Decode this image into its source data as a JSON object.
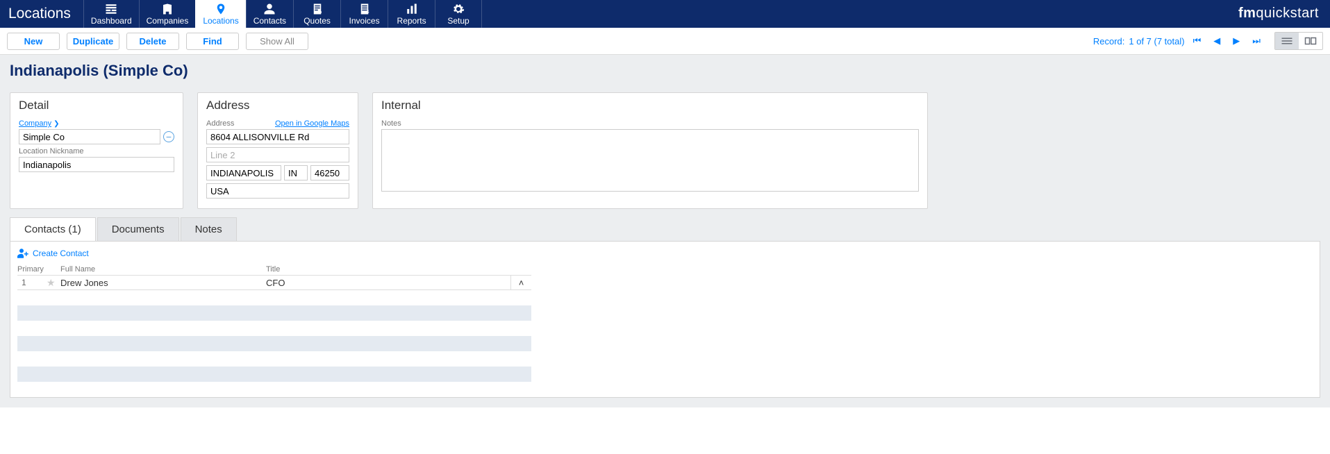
{
  "app": {
    "section_title": "Locations",
    "brand_prefix": "fm",
    "brand_main": "quickstart"
  },
  "nav": [
    {
      "label": "Dashboard",
      "active": false
    },
    {
      "label": "Companies",
      "active": false
    },
    {
      "label": "Locations",
      "active": true
    },
    {
      "label": "Contacts",
      "active": false
    },
    {
      "label": "Quotes",
      "active": false
    },
    {
      "label": "Invoices",
      "active": false
    },
    {
      "label": "Reports",
      "active": false
    },
    {
      "label": "Setup",
      "active": false
    }
  ],
  "toolbar": {
    "new": "New",
    "duplicate": "Duplicate",
    "delete": "Delete",
    "find": "Find",
    "show_all": "Show All",
    "record_label": "Record:",
    "record_status": "1 of 7 (7 total)"
  },
  "page": {
    "title": "Indianapolis (Simple Co)"
  },
  "detail": {
    "heading": "Detail",
    "company_link": "Company",
    "company_value": "Simple Co",
    "nickname_label": "Location Nickname",
    "nickname_value": "Indianapolis"
  },
  "address": {
    "heading": "Address",
    "label": "Address",
    "maps_link": "Open in Google Maps",
    "line1": "8604 ALLISONVILLE Rd",
    "line2_placeholder": "Line 2",
    "city": "INDIANAPOLIS",
    "state": "IN",
    "zip": "46250",
    "country": "USA"
  },
  "internal": {
    "heading": "Internal",
    "notes_label": "Notes"
  },
  "tabs": {
    "contacts": "Contacts (1)",
    "documents": "Documents",
    "notes": "Notes"
  },
  "contacts": {
    "create": "Create Contact",
    "cols": {
      "primary": "Primary",
      "fullname": "Full Name",
      "title": "Title"
    },
    "rows": [
      {
        "primary": "1",
        "name": "Drew Jones",
        "title": "CFO"
      }
    ]
  }
}
